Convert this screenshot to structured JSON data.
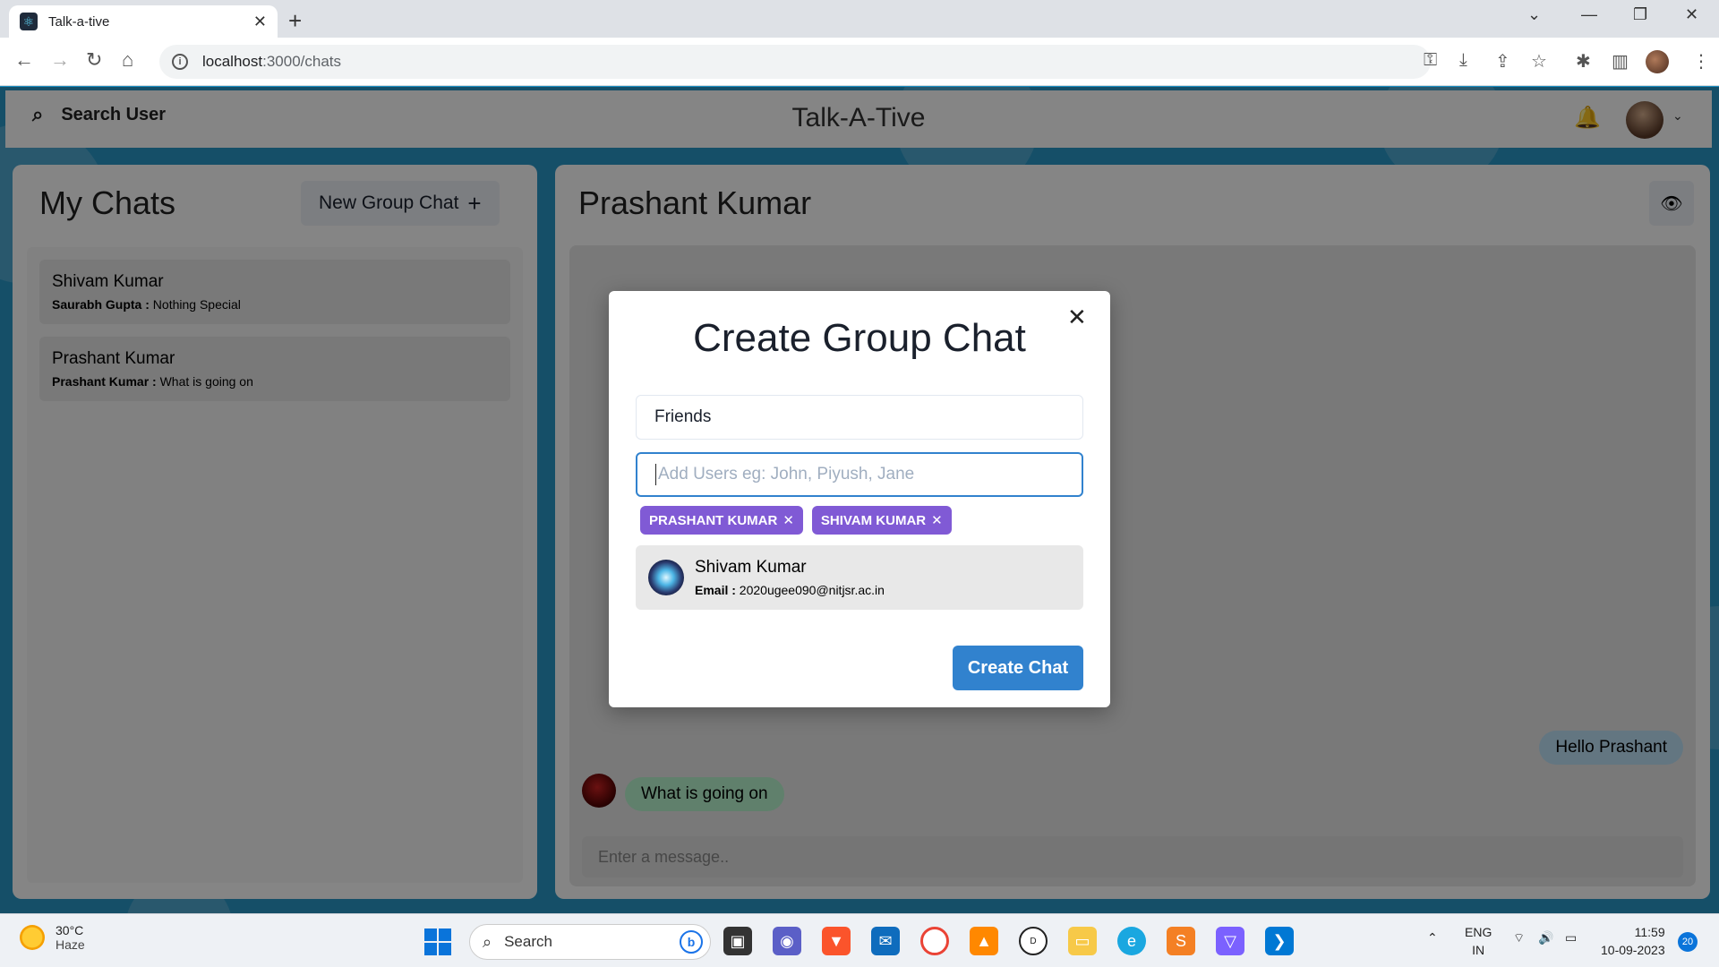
{
  "browser": {
    "tab_title": "Talk-a-tive",
    "url_host": "localhost",
    "url_path": ":3000/chats"
  },
  "header": {
    "search_label": "Search User",
    "brand": "Talk-A-Tive"
  },
  "my_chats": {
    "title": "My Chats",
    "new_group_label": "New Group Chat",
    "chats": [
      {
        "name": "Shivam Kumar",
        "sender": "Saurabh Gupta :",
        "message": "Nothing Special"
      },
      {
        "name": "Prashant Kumar",
        "sender": "Prashant Kumar :",
        "message": "What is going on"
      }
    ]
  },
  "chat_box": {
    "title": "Prashant Kumar",
    "messages": [
      {
        "text": "Hello Prashant",
        "side": "right"
      },
      {
        "text": "What is going on",
        "side": "left"
      }
    ],
    "input_placeholder": "Enter a message.."
  },
  "modal": {
    "title": "Create Group Chat",
    "group_name_value": "Friends",
    "add_users_placeholder": "Add Users eg: John, Piyush, Jane",
    "selected_users": [
      "PRASHANT KUMAR",
      "SHIVAM KUMAR"
    ],
    "search_result": {
      "name": "Shivam Kumar",
      "email_label": "Email :",
      "email": "2020ugee090@nitjsr.ac.in"
    },
    "create_label": "Create Chat"
  },
  "taskbar": {
    "temperature": "30°C",
    "weather": "Haze",
    "search_label": "Search",
    "lang1": "ENG",
    "lang2": "IN",
    "time": "11:59",
    "date": "10-09-2023",
    "notification_count": "20"
  }
}
